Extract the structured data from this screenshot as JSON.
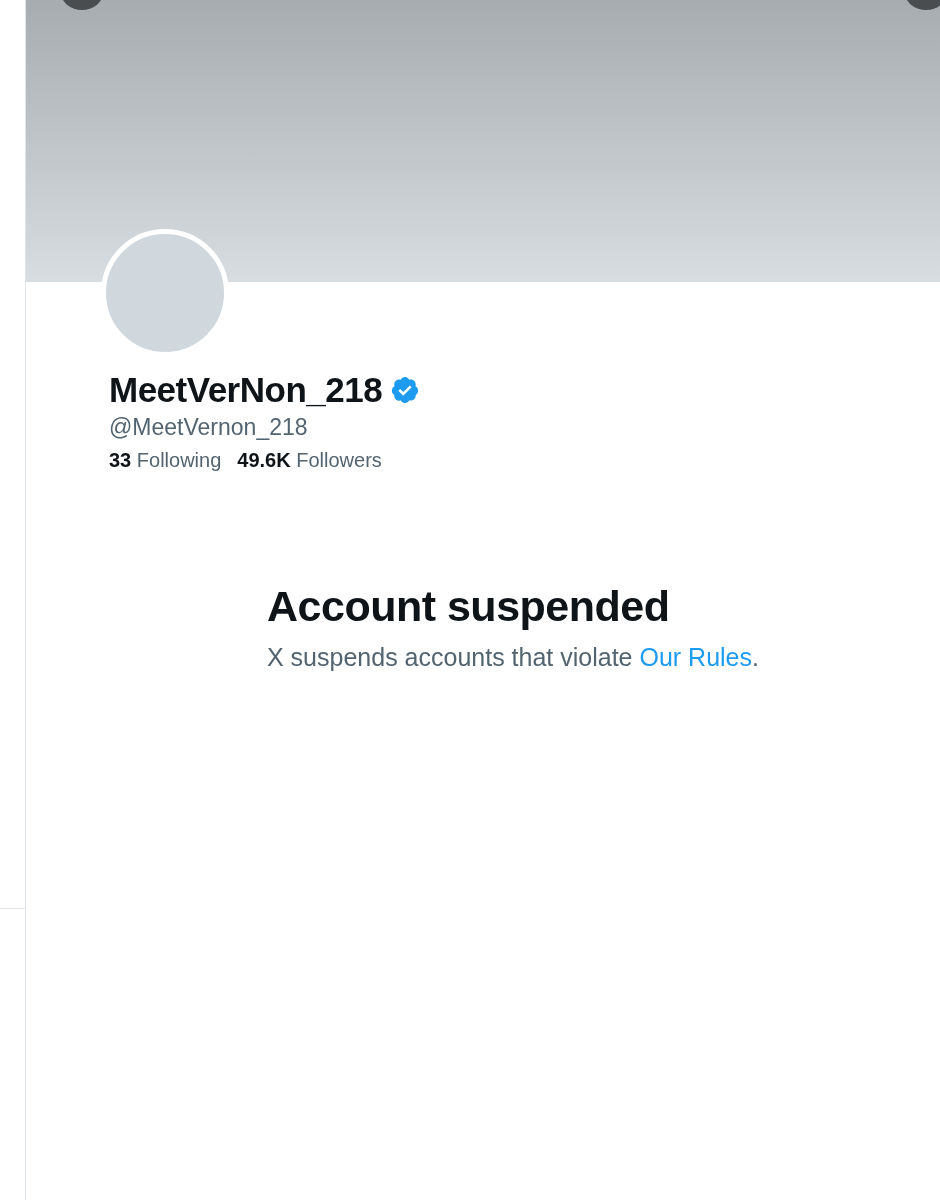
{
  "profile": {
    "name": "MeetVerNon_218",
    "verified": true,
    "handle": "@MeetVernon_218",
    "stats": [
      {
        "count": "33",
        "label": "Following"
      },
      {
        "count": "49.6K",
        "label": "Followers"
      }
    ]
  },
  "notice": {
    "title": "Account suspended",
    "text": "X suspends accounts that violate",
    "link": "Our Rules",
    "end": "."
  }
}
